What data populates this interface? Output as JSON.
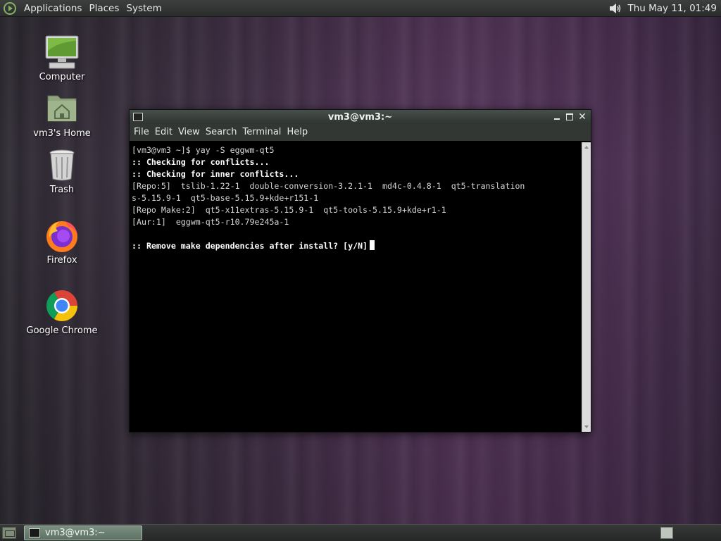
{
  "top_panel": {
    "menu": [
      "Applications",
      "Places",
      "System"
    ],
    "clock": "Thu May 11, 01:49"
  },
  "desktop_icons": [
    {
      "label": "Computer",
      "icon": "computer-icon"
    },
    {
      "label": "vm3's Home",
      "icon": "home-folder-icon"
    },
    {
      "label": "Trash",
      "icon": "trash-icon"
    },
    {
      "label": "Firefox",
      "icon": "firefox-icon"
    },
    {
      "label": "Google Chrome",
      "icon": "chrome-icon"
    }
  ],
  "window": {
    "title": "vm3@vm3:~",
    "menu": [
      "File",
      "Edit",
      "View",
      "Search",
      "Terminal",
      "Help"
    ],
    "terminal_lines": [
      {
        "text": "[vm3@vm3 ~]$ yay -S eggwm-qt5",
        "bold": false
      },
      {
        "text": ":: Checking for conflicts...",
        "bold": true
      },
      {
        "text": ":: Checking for inner conflicts...",
        "bold": true
      },
      {
        "text": "[Repo:5]  tslib-1.22-1  double-conversion-3.2.1-1  md4c-0.4.8-1  qt5-translation",
        "bold": false
      },
      {
        "text": "s-5.15.9-1  qt5-base-5.15.9+kde+r151-1",
        "bold": false
      },
      {
        "text": "[Repo Make:2]  qt5-x11extras-5.15.9-1  qt5-tools-5.15.9+kde+r1-1",
        "bold": false
      },
      {
        "text": "[Aur:1]  eggwm-qt5-r10.79e245a-1",
        "bold": false
      },
      {
        "text": "",
        "bold": false
      },
      {
        "text": ":: Remove make dependencies after install? [y/N]",
        "bold": true,
        "cursor": true
      }
    ]
  },
  "bottom_panel": {
    "task_label": "vm3@vm3:~"
  },
  "colors": {
    "panel": "#2b2d2c",
    "terminal_bg": "#000000",
    "terminal_fg": "#d6d6d6",
    "task_button": "#6b8071"
  }
}
